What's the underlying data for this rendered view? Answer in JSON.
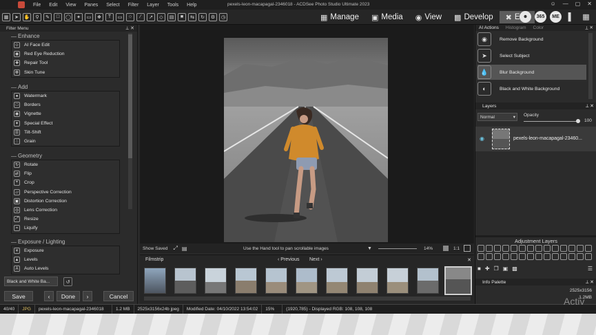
{
  "menubar": {
    "items": [
      "File",
      "Edit",
      "View",
      "Panes",
      "Select",
      "Filter",
      "Layer",
      "Tools",
      "Help"
    ],
    "title": "pexels-leon-macapagal-2346018 - ACDSee Photo Studio Ultimate 2023"
  },
  "modes": [
    {
      "icon": "grid-icon",
      "label": "Manage"
    },
    {
      "icon": "media-icon",
      "label": "Media"
    },
    {
      "icon": "eye-icon",
      "label": "View"
    },
    {
      "icon": "develop-icon",
      "label": "Develop"
    },
    {
      "icon": "edit-icon",
      "label": "Edit"
    }
  ],
  "toolbar_badges": [
    "365",
    "ME"
  ],
  "filter_menu": {
    "title": "Filter Menu",
    "groups": [
      {
        "title": "Enhance",
        "items": [
          "AI Face Edit",
          "Red Eye Reduction",
          "Repair Tool",
          "Skin Tune"
        ]
      },
      {
        "title": "Add",
        "items": [
          "Watermark",
          "Borders",
          "Vignette",
          "Special Effect",
          "Tilt-Shift",
          "Grain"
        ]
      },
      {
        "title": "Geometry",
        "items": [
          "Rotate",
          "Flip",
          "Crop",
          "Perspective Correction",
          "Distortion Correction",
          "Lens Correction",
          "Resize",
          "Liquify"
        ]
      },
      {
        "title": "Exposure / Lighting",
        "items": [
          "Exposure",
          "Levels",
          "Auto Levels"
        ]
      }
    ],
    "preset_value": "Black and White Ba...",
    "save_label": "Save",
    "done_label": "Done",
    "cancel_label": "Cancel"
  },
  "status_row": {
    "show_saved": "Show Saved",
    "hint": "Use the Hand tool to pan scrollable images",
    "zoom": "14%",
    "ratio": "1:1"
  },
  "filmstrip": {
    "title": "Filmstrip",
    "previous": "Previous",
    "next": "Next"
  },
  "right_panel": {
    "tabs": [
      "AI Actions",
      "Histogram",
      "Color"
    ],
    "ai_actions": [
      "Remove Background",
      "Select Subject",
      "Blur Background",
      "Black and White Background"
    ],
    "active_action": 2,
    "layers_title": "Layers",
    "blend_mode": "Normal",
    "opacity_label": "Opacity",
    "opacity_value": "100",
    "layer_name": "pexels-leon-macapagal-23460...",
    "adjustment_title": "Adjustment Layers",
    "info_title": "Info Palette",
    "info_dims": "2525x3156",
    "info_size": "1.2MB"
  },
  "bottombar": {
    "count": "40/40",
    "format": "JPG",
    "filename": "pexels-leon-macapagal-2346018",
    "size": "1.2 MB",
    "dims": "2525x3156x24b jpeg",
    "modified": "Modified Date: 04/10/2022 13:54:02",
    "zoom": "15%",
    "rgb": "(1920,785) - Displayed RGB: 108, 108, 108"
  },
  "watermark_text": "Activ"
}
